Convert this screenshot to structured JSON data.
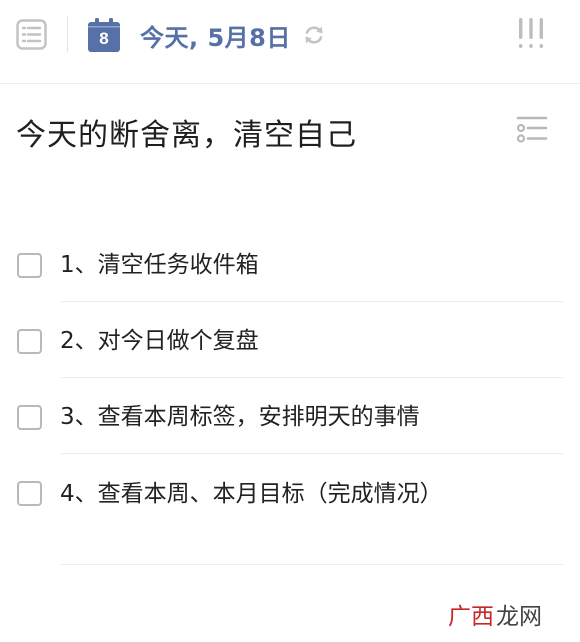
{
  "header": {
    "calendar_day": "8",
    "date_title": "今天, 5月8日",
    "icons": [
      "list-menu-icon",
      "calendar-icon",
      "sync-icon",
      "priority-icon"
    ],
    "accent_color": "#5670a8"
  },
  "task": {
    "title": "今天的断舍离，清空自己",
    "title_icon": "checklist-icon"
  },
  "checklist": [
    {
      "text": "1、清空任务收件箱",
      "checked": false
    },
    {
      "text": "2、对今日做个复盘",
      "checked": false
    },
    {
      "text": "3、查看本周标签，安排明天的事情",
      "checked": false
    },
    {
      "text": "4、查看本周、本月目标（完成情况）",
      "checked": false
    }
  ],
  "watermark": {
    "text": "广西龙网"
  }
}
